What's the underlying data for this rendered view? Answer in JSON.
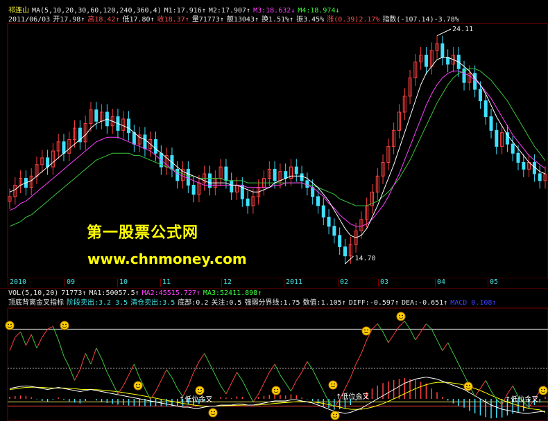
{
  "header": {
    "line1": [
      {
        "text": "祁连山",
        "color": "y"
      },
      {
        "text": "MA(5,10,20,30,60,120,240,360,4)",
        "color": "w"
      },
      {
        "text": "M1:17.916↑",
        "color": "w"
      },
      {
        "text": "M2:17.907↑",
        "color": "w"
      },
      {
        "text": "M3:18.632↓",
        "color": "m"
      },
      {
        "text": "M4:18.974↓",
        "color": "g"
      }
    ],
    "line2": [
      {
        "text": "2011/06/03",
        "color": "w"
      },
      {
        "text": "开17.98↑",
        "color": "w"
      },
      {
        "text": "高18.42↑",
        "color": "r"
      },
      {
        "text": "低17.80↑",
        "color": "w"
      },
      {
        "text": "收18.37↑",
        "color": "r"
      },
      {
        "text": "量71773↑",
        "color": "w"
      },
      {
        "text": "额13043↑",
        "color": "w"
      },
      {
        "text": "换1.51%↑",
        "color": "w"
      },
      {
        "text": "振3.45%",
        "color": "w"
      },
      {
        "text": "涨(0.39)2.17%",
        "color": "r"
      },
      {
        "text": "指数(-107.14)-3.78%",
        "color": "w"
      }
    ]
  },
  "price_high_label": "24.11",
  "price_low_label": "14.70",
  "watermark": {
    "line1": "第一股票公式网",
    "line2": "www.chnmoney.com"
  },
  "date_axis": [
    "2010",
    "09",
    "10",
    "11",
    "12",
    "2011",
    "02",
    "03",
    "04",
    "05"
  ],
  "volume_line": [
    {
      "text": "VOL(5,10,20)",
      "color": "w"
    },
    {
      "text": "71773↑",
      "color": "w"
    },
    {
      "text": "MA1:50057.5↑",
      "color": "w"
    },
    {
      "text": "MA2:45515.727↑",
      "color": "m"
    },
    {
      "text": "MA3:52411.898↑",
      "color": "g"
    }
  ],
  "indicator_line": [
    {
      "text": "顶底背离金叉指标",
      "color": "w"
    },
    {
      "text": "阶段卖出:3.2 3.5",
      "color": "c"
    },
    {
      "text": "清仓卖出:3.5",
      "color": "c"
    },
    {
      "text": "底部:0.2",
      "color": "w"
    },
    {
      "text": "关注:0.5",
      "color": "w"
    },
    {
      "text": "强弱分界线:1.75",
      "color": "w"
    },
    {
      "text": "数值:1.105↑",
      "color": "w"
    },
    {
      "text": "DIFF:-0.597↑",
      "color": "w"
    },
    {
      "text": "DEA:-0.651↑",
      "color": "w"
    },
    {
      "text": "MACD 0.108↑",
      "color": "b"
    }
  ],
  "signal_labels": [
    "低位金叉",
    "低位金叉",
    "低位金叉",
    "低位金叉"
  ],
  "colors": {
    "up": "#ff4040",
    "down": "#40e0ff",
    "ma_white": "#ffffff",
    "ma_yellow": "#ffff00",
    "ma_magenta": "#ff40ff",
    "ma_green": "#3cc83c",
    "frame": "#800000"
  },
  "chart_data": {
    "type": "line",
    "title": "",
    "ylim": [
      14.0,
      24.8
    ],
    "close": [
      17.4,
      17.9,
      18.2,
      17.8,
      18.3,
      18.8,
      19.1,
      18.7,
      19.4,
      19.8,
      19.3,
      19.9,
      20.4,
      19.8,
      20.6,
      21.2,
      20.7,
      21.1,
      20.5,
      20.9,
      20.3,
      20.8,
      20.2,
      19.7,
      20.1,
      19.5,
      19.9,
      19.3,
      18.7,
      19.2,
      18.6,
      18.1,
      18.6,
      17.9,
      17.5,
      18.0,
      18.4,
      17.8,
      18.2,
      18.7,
      18.1,
      17.6,
      17.9,
      17.3,
      17.0,
      17.4,
      17.8,
      18.2,
      18.6,
      18.1,
      18.5,
      18.2,
      18.7,
      18.4,
      18.1,
      17.8,
      17.4,
      17.0,
      16.5,
      16.1,
      15.7,
      15.2,
      14.8,
      15.3,
      15.9,
      16.4,
      17.0,
      17.6,
      18.3,
      18.9,
      19.6,
      20.3,
      21.1,
      21.8,
      22.6,
      23.3,
      23.6,
      23.1,
      23.8,
      24.1,
      23.5,
      23.2,
      23.6,
      23.0,
      22.4,
      22.8,
      22.1,
      21.6,
      20.9,
      20.3,
      19.6,
      20.2,
      19.7,
      19.3,
      18.9,
      18.6,
      18.9,
      18.4,
      18.1,
      18.37
    ],
    "ma_white": [
      17.6,
      17.7,
      17.9,
      18.0,
      18.1,
      18.3,
      18.5,
      18.7,
      18.9,
      19.1,
      19.3,
      19.5,
      19.7,
      19.9,
      20.1,
      20.4,
      20.6,
      20.7,
      20.8,
      20.7,
      20.6,
      20.5,
      20.4,
      20.2,
      20.0,
      19.9,
      19.7,
      19.5,
      19.3,
      19.1,
      18.9,
      18.7,
      18.5,
      18.4,
      18.3,
      18.2,
      18.1,
      18.0,
      18.0,
      18.0,
      18.0,
      17.9,
      17.9,
      17.8,
      17.7,
      17.6,
      17.6,
      17.7,
      17.8,
      18.0,
      18.1,
      18.2,
      18.3,
      18.3,
      18.3,
      18.2,
      18.0,
      17.8,
      17.5,
      17.2,
      16.8,
      16.4,
      16.0,
      15.7,
      15.6,
      15.7,
      16.0,
      16.5,
      17.0,
      17.6,
      18.2,
      18.8,
      19.5,
      20.2,
      20.9,
      21.6,
      22.3,
      22.8,
      23.1,
      23.4,
      23.5,
      23.5,
      23.4,
      23.3,
      23.1,
      22.9,
      22.6,
      22.3,
      21.9,
      21.4,
      20.9,
      20.5,
      20.1,
      19.8,
      19.5,
      19.2,
      18.9,
      18.7,
      18.5,
      18.4
    ],
    "ma_magenta": [
      16.8,
      16.9,
      17.1,
      17.2,
      17.4,
      17.6,
      17.8,
      18.0,
      18.2,
      18.4,
      18.6,
      18.8,
      19.0,
      19.2,
      19.4,
      19.6,
      19.8,
      19.9,
      20.0,
      20.0,
      20.0,
      19.9,
      19.8,
      19.7,
      19.6,
      19.5,
      19.4,
      19.2,
      19.0,
      18.8,
      18.6,
      18.4,
      18.3,
      18.2,
      18.1,
      18.0,
      17.9,
      17.9,
      17.9,
      17.9,
      17.9,
      17.9,
      17.9,
      17.9,
      17.8,
      17.8,
      17.8,
      17.8,
      17.8,
      17.9,
      17.9,
      18.0,
      18.0,
      18.0,
      18.0,
      17.9,
      17.8,
      17.6,
      17.4,
      17.1,
      16.9,
      16.6,
      16.4,
      16.2,
      16.1,
      16.1,
      16.2,
      16.4,
      16.7,
      17.0,
      17.4,
      17.9,
      18.4,
      19.0,
      19.6,
      20.2,
      20.8,
      21.4,
      21.9,
      22.3,
      22.6,
      22.8,
      22.9,
      22.9,
      22.8,
      22.7,
      22.5,
      22.3,
      22.0,
      21.7,
      21.3,
      20.9,
      20.5,
      20.1,
      19.8,
      19.5,
      19.2,
      19.0,
      18.8,
      18.63
    ],
    "ma_green": [
      16.1,
      16.2,
      16.3,
      16.5,
      16.6,
      16.8,
      17.0,
      17.2,
      17.4,
      17.6,
      17.8,
      18.0,
      18.2,
      18.4,
      18.6,
      18.8,
      19.0,
      19.1,
      19.2,
      19.3,
      19.3,
      19.3,
      19.3,
      19.2,
      19.2,
      19.1,
      19.0,
      18.9,
      18.8,
      18.7,
      18.6,
      18.5,
      18.4,
      18.3,
      18.3,
      18.2,
      18.2,
      18.2,
      18.2,
      18.2,
      18.1,
      18.1,
      18.1,
      18.1,
      18.0,
      18.0,
      18.0,
      18.0,
      18.0,
      18.0,
      18.0,
      18.0,
      18.0,
      18.0,
      18.0,
      17.9,
      17.9,
      17.8,
      17.7,
      17.6,
      17.5,
      17.3,
      17.2,
      17.1,
      17.0,
      17.0,
      17.0,
      17.1,
      17.2,
      17.4,
      17.6,
      17.9,
      18.2,
      18.6,
      19.0,
      19.5,
      20.0,
      20.5,
      21.0,
      21.5,
      21.9,
      22.3,
      22.6,
      22.8,
      22.9,
      23.0,
      23.0,
      22.9,
      22.7,
      22.5,
      22.2,
      21.9,
      21.6,
      21.2,
      20.8,
      20.4,
      20.0,
      19.6,
      19.3,
      18.97
    ],
    "indicator": [
      2.4,
      2.9,
      3.1,
      2.6,
      3.0,
      2.5,
      2.9,
      3.2,
      3.3,
      2.8,
      2.2,
      1.8,
      1.3,
      1.7,
      2.3,
      1.9,
      2.5,
      2.1,
      1.6,
      1.2,
      0.8,
      1.1,
      1.5,
      1.9,
      1.4,
      1.0,
      0.6,
      0.9,
      1.3,
      1.7,
      1.4,
      1.0,
      0.7,
      1.1,
      1.6,
      2.0,
      2.3,
      1.9,
      1.5,
      1.1,
      0.8,
      1.2,
      1.6,
      1.3,
      0.9,
      0.5,
      0.8,
      1.2,
      1.6,
      1.9,
      1.5,
      1.2,
      0.9,
      1.3,
      1.6,
      2.0,
      1.7,
      1.3,
      0.9,
      0.5,
      0.3,
      0.6,
      1.0,
      1.4,
      1.9,
      2.3,
      2.8,
      3.2,
      3.4,
      3.1,
      2.7,
      3.0,
      3.3,
      3.5,
      3.2,
      2.8,
      3.1,
      3.4,
      3.2,
      2.8,
      2.4,
      2.7,
      2.3,
      1.9,
      1.5,
      1.1,
      0.7,
      1.0,
      1.3,
      0.9,
      0.6,
      0.4,
      0.8,
      1.1,
      0.7,
      0.5,
      0.3,
      0.6,
      0.9,
      1.1
    ],
    "diff": [
      0.5,
      0.55,
      0.6,
      0.62,
      0.6,
      0.55,
      0.5,
      0.45,
      0.5,
      0.55,
      0.5,
      0.45,
      0.4,
      0.35,
      0.4,
      0.45,
      0.4,
      0.35,
      0.3,
      0.25,
      0.2,
      0.15,
      0.1,
      0.05,
      0.0,
      -0.05,
      -0.1,
      -0.15,
      -0.2,
      -0.25,
      -0.3,
      -0.35,
      -0.4,
      -0.4,
      -0.45,
      -0.45,
      -0.4,
      -0.35,
      -0.35,
      -0.3,
      -0.3,
      -0.3,
      -0.25,
      -0.25,
      -0.3,
      -0.3,
      -0.25,
      -0.2,
      -0.15,
      -0.1,
      -0.1,
      -0.1,
      -0.05,
      -0.05,
      -0.1,
      -0.15,
      -0.2,
      -0.3,
      -0.4,
      -0.5,
      -0.6,
      -0.65,
      -0.7,
      -0.65,
      -0.55,
      -0.45,
      -0.3,
      -0.15,
      0.0,
      0.15,
      0.3,
      0.45,
      0.6,
      0.75,
      0.85,
      0.95,
      1.0,
      1.05,
      1.0,
      0.95,
      0.85,
      0.75,
      0.65,
      0.55,
      0.45,
      0.3,
      0.15,
      0.0,
      -0.15,
      -0.3,
      -0.4,
      -0.5,
      -0.55,
      -0.6,
      -0.65,
      -0.7,
      -0.7,
      -0.65,
      -0.62,
      -0.597
    ],
    "dea": [
      0.45,
      0.48,
      0.52,
      0.55,
      0.56,
      0.56,
      0.55,
      0.53,
      0.52,
      0.52,
      0.52,
      0.51,
      0.49,
      0.46,
      0.45,
      0.45,
      0.44,
      0.42,
      0.4,
      0.37,
      0.34,
      0.3,
      0.26,
      0.22,
      0.18,
      0.13,
      0.08,
      0.03,
      -0.02,
      -0.07,
      -0.12,
      -0.17,
      -0.22,
      -0.26,
      -0.3,
      -0.33,
      -0.35,
      -0.35,
      -0.35,
      -0.34,
      -0.33,
      -0.32,
      -0.31,
      -0.3,
      -0.3,
      -0.3,
      -0.29,
      -0.27,
      -0.25,
      -0.22,
      -0.2,
      -0.18,
      -0.16,
      -0.14,
      -0.13,
      -0.14,
      -0.15,
      -0.18,
      -0.22,
      -0.28,
      -0.34,
      -0.4,
      -0.46,
      -0.5,
      -0.51,
      -0.5,
      -0.46,
      -0.4,
      -0.32,
      -0.23,
      -0.12,
      0.0,
      0.12,
      0.25,
      0.37,
      0.49,
      0.59,
      0.68,
      0.75,
      0.79,
      0.8,
      0.79,
      0.76,
      0.72,
      0.66,
      0.59,
      0.5,
      0.4,
      0.29,
      0.17,
      0.06,
      -0.05,
      -0.15,
      -0.24,
      -0.32,
      -0.4,
      -0.46,
      -0.5,
      -0.53,
      -0.651
    ]
  }
}
